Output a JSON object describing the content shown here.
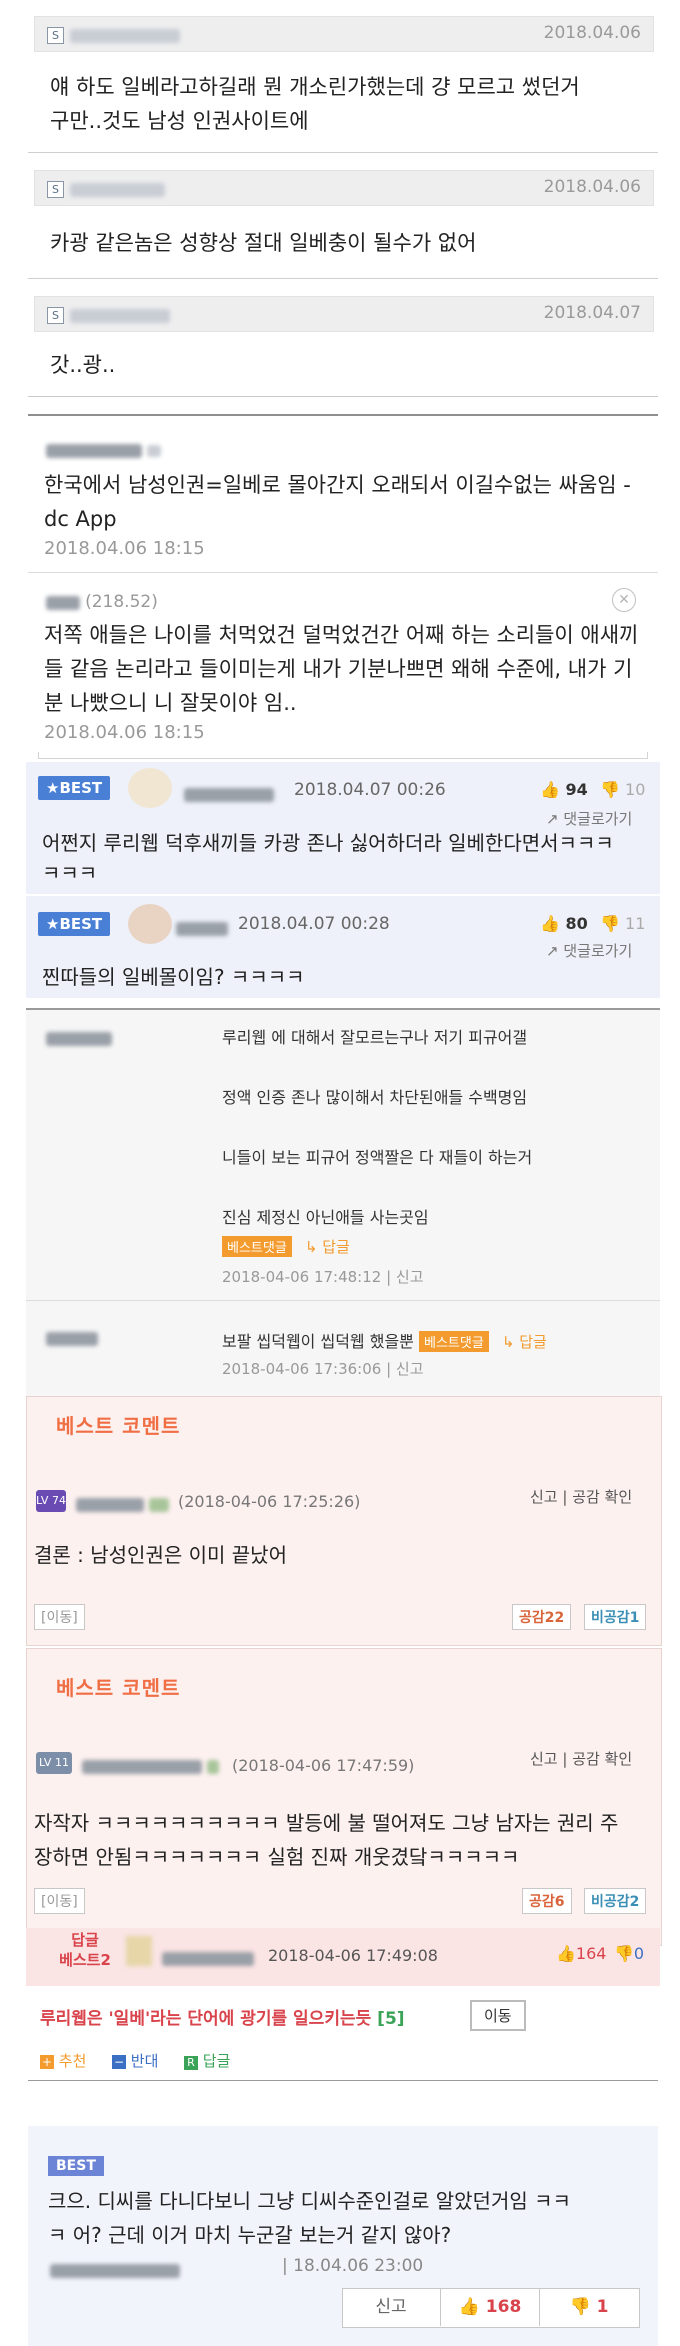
{
  "comments_a": [
    {
      "date": "2018.04.06",
      "text1": "얘 하도 일베라고하길래 뭔 개소린가했는데 걍 모르고 썼던거",
      "text2": "구만..것도 남성 인권사이트에"
    },
    {
      "date": "2018.04.06",
      "text1": "카광 같은놈은 성향상 절대 일베충이 될수가 없어"
    },
    {
      "date": "2018.04.07",
      "text1": "갓..광.."
    }
  ],
  "comments_b": [
    {
      "text1": "한국에서 남성인권=일베로 몰아간지 오래되서 이길수없는 싸움임 -",
      "text2": "dc App",
      "date": "2018.04.06 18:15"
    },
    {
      "ip": "(218.52)",
      "text1": "저쪽 애들은 나이를 처먹었건 덜먹었건간 어째 하는 소리들이 애새끼",
      "text2": "들 같음 논리라고 들이미는게 내가 기분나쁘면 왜해 수준에, 내가 기",
      "text3": "분 나빴으니 니 잘못이야 임..",
      "date": "2018.04.06 18:15"
    }
  ],
  "best": {
    "badge": "★BEST",
    "reply_label": "댓글로가기",
    "items": [
      {
        "date": "2018.04.07 00:26",
        "up": "94",
        "down": "10",
        "text1": "어쩐지 루리웹 덕후새끼들 카광 존나 싫어하더라 일베한다면서ㅋㅋㅋ",
        "text2": "ㅋㅋㅋ"
      },
      {
        "date": "2018.04.07 00:28",
        "up": "80",
        "down": "11",
        "text1": "찐따들의 일베몰이임? ㅋㅋㅋㅋ"
      }
    ]
  },
  "ruliweb": {
    "lines": [
      "루리웹 에 대해서 잘모르는구나 저기 피규어갤",
      "정액 인증 존나 많이해서 차단된애들 수백명임",
      "니들이 보는 피규어 정액짤은 다 재들이 하는거",
      "진심 제정신 아닌애들 사는곳임"
    ],
    "tag": "베스트댓글",
    "reply": "↳ 답글",
    "meta1": "2018-04-06 17:48:12 | 신고",
    "line2": "보팔 씹덕웹이 씹덕웹 했을뿐",
    "meta2": "2018-04-06 17:36:06 | 신고"
  },
  "best_comment_title": "베스트 코멘트",
  "bc": [
    {
      "lv": "LV 74",
      "date": "(2018-04-06 17:25:26)",
      "actions": "신고 | 공감 확인",
      "text1": "결론 : 남성인권은 이미 끝났어",
      "move": "[이동]",
      "agree": "공감22",
      "disagree": "비공감1"
    },
    {
      "lv": "LV 11",
      "date": "(2018-04-06 17:47:59)",
      "actions": "신고 | 공감 확인",
      "text1": "자작자 ㅋㅋㅋㅋㅋㅋㅋㅋㅋㅋ 발등에 불 떨어져도 그냥 남자는 권리 주",
      "text2": "장하면 안됨ㅋㅋㅋㅋㅋㅋㅋ 실험 진짜 개웃겼닼ㅋㅋㅋㅋㅋ",
      "move": "[이동]",
      "agree": "공감6",
      "disagree": "비공감2"
    }
  ],
  "reply_best2": {
    "label1": "답글",
    "label2": "베스트2",
    "date": "2018-04-06 17:49:08",
    "up": "164",
    "down": "0"
  },
  "article": {
    "title": "루리웹은 '일베'라는 단어에 광기를 일으키는듯",
    "count": "[5]",
    "move_btn": "이동",
    "recommend": "추천",
    "oppose": "반대",
    "reply": "답글"
  },
  "final": {
    "badge": "BEST",
    "text1": "크으. 디씨를 다니다보니 그냥 디씨수준인걸로 알았던거임 ㅋㅋ",
    "text2": "ㅋ 어? 근데 이거 마치 누군갈 보는거 같지 않아?",
    "date": "| 18.04.06 23:00",
    "report": "신고",
    "up": "168",
    "down": "1"
  },
  "colors": {
    "best_blue": "#4a7fd6",
    "orange": "#f39b2e",
    "red": "#d9434b",
    "green": "#3aa357"
  }
}
